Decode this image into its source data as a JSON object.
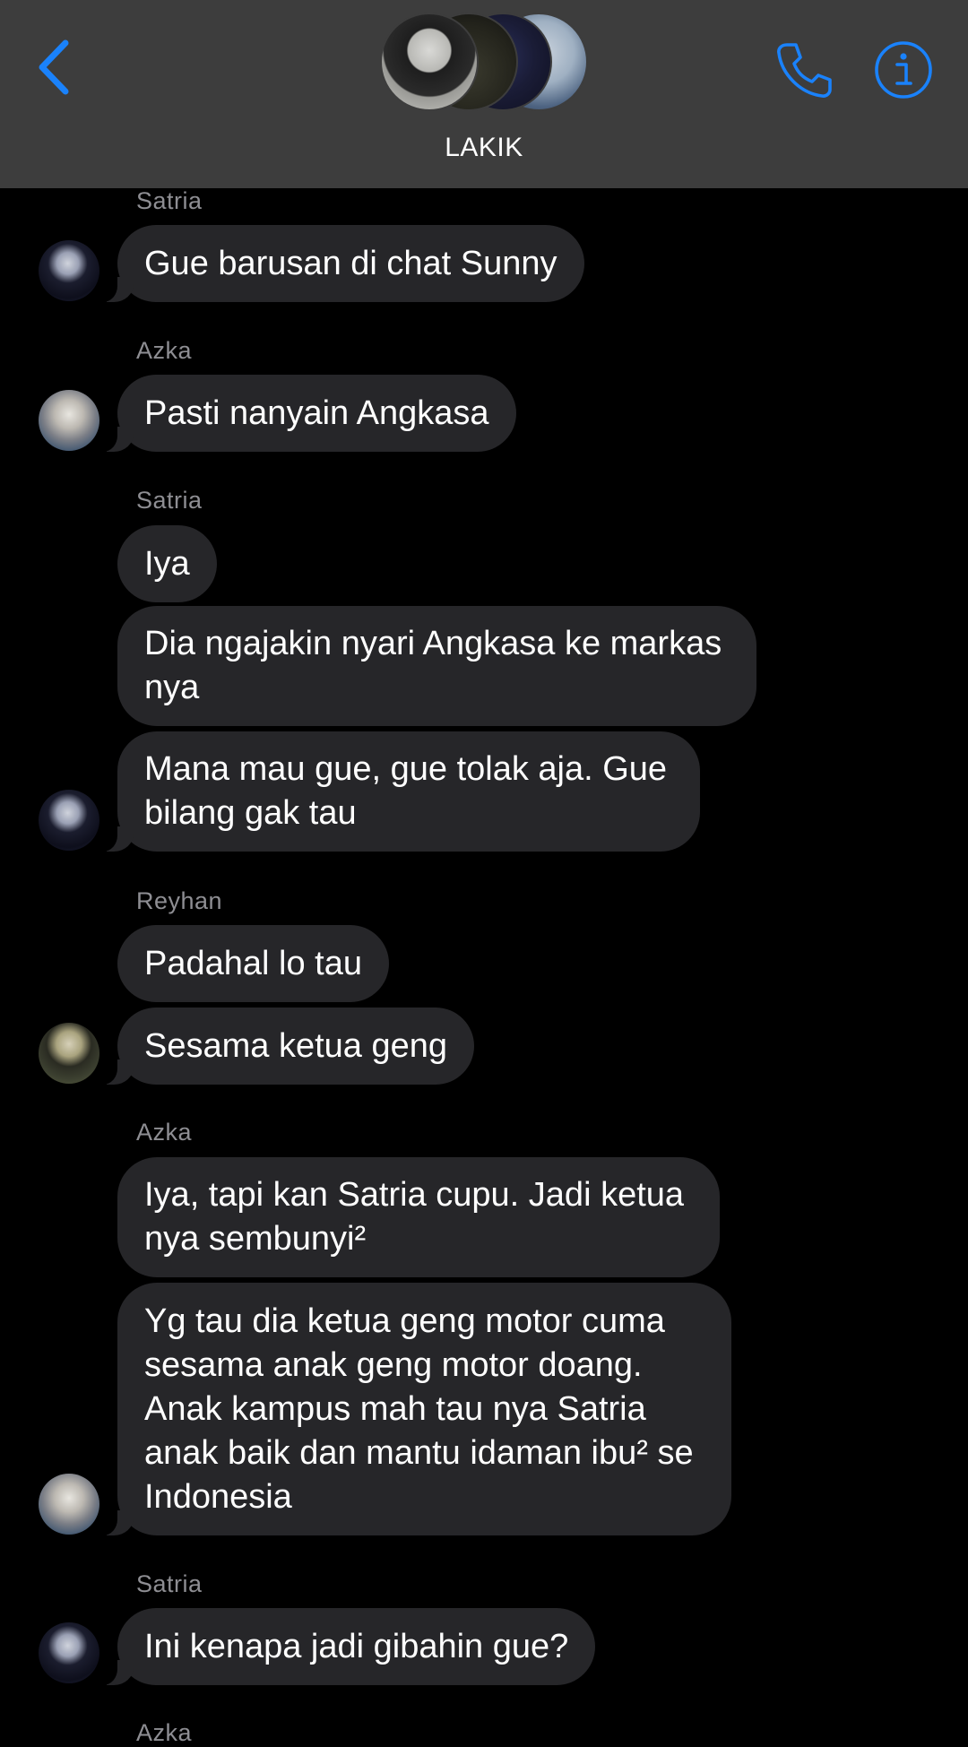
{
  "header": {
    "group_name": "LAKIK",
    "accent_color": "#1a82fb",
    "back_icon": "chevron-left-icon",
    "call_icon": "phone-icon",
    "info_icon": "info-icon"
  },
  "messages": [
    {
      "sender": "Satria",
      "bubbles": [
        "Gue barusan di chat Sunny"
      ]
    },
    {
      "sender": "Azka",
      "bubbles": [
        "Pasti nanyain Angkasa"
      ]
    },
    {
      "sender": "Satria",
      "bubbles": [
        "Iya",
        "Dia ngajakin nyari Angkasa ke markas nya",
        "Mana mau gue, gue tolak aja. Gue bilang gak tau"
      ]
    },
    {
      "sender": "Reyhan",
      "bubbles": [
        "Padahal lo tau",
        "Sesama ketua geng"
      ]
    },
    {
      "sender": "Azka",
      "bubbles": [
        "Iya, tapi kan Satria cupu. Jadi ketua nya sembunyi²",
        "Yg tau dia ketua geng motor cuma sesama anak geng motor doang. Anak kampus mah tau nya Satria anak baik dan mantu idaman ibu² se Indonesia"
      ]
    },
    {
      "sender": "Satria",
      "bubbles": [
        "Ini kenapa jadi gibahin gue?"
      ]
    },
    {
      "sender": "Azka",
      "bubbles": []
    }
  ]
}
